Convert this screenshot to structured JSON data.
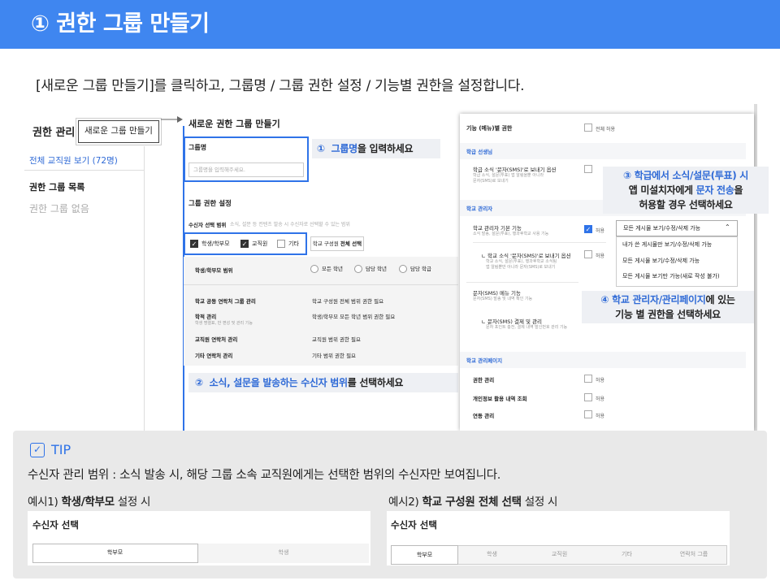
{
  "banner": {
    "title": "① 권한 그룹 만들기",
    "color": "#3f86f0"
  },
  "instruction": "[새로운 그룹 만들기]를 클릭하고, 그룹명 / 그룹 권한 설정 / 기능별 권한을 설정합니다.",
  "left": {
    "title": "권한 관리",
    "new_group_button": "새로운 그룹 만들기",
    "view_all": "전체 교직원 보기 (72명)",
    "group_list_title": "권한 그룹 목록",
    "no_group": "권한 그룹 없음"
  },
  "middle": {
    "title": "새로운 권한 그룹 만들기",
    "group_name_label": "그룹명",
    "group_name_placeholder": "그룹명을 입력해주세요.",
    "callout1": {
      "num": "①",
      "highlight": "그룹명",
      "rest": "을 입력하세요"
    },
    "perm_title": "그룹 권한 설정",
    "recipient_label": "수신자 선택 범위",
    "recipient_desc": "소식, 설문 등 컨텐츠 발송 시 수신자로 선택할 수 있는 범위",
    "checkboxes": [
      {
        "label": "학생/학부모",
        "checked": true
      },
      {
        "label": "교직원",
        "checked": true
      },
      {
        "label": "기타",
        "checked": false
      }
    ],
    "select_all_button": {
      "prefix": "학교 구성원 ",
      "bold": "전체 선택"
    },
    "scope_label": "학생/학부모 범위",
    "scope_radios": [
      "모든 학년",
      "담당 학년",
      "담당 학급"
    ],
    "scope_rows": [
      {
        "left": "학교 공동 연락처 그룹 관리",
        "sub": "",
        "right": "학교 구성원 전체 범위 권한 필요"
      },
      {
        "left": "학적 관리",
        "sub": "학생 명렬표, 반 편성 및 관리 기능",
        "right": "학생/학부모 모든 학년 범위 권한 필요"
      },
      {
        "left": "교직원 연락처 관리",
        "sub": "",
        "right": "교직원 범위 권한 필요"
      },
      {
        "left": "기타 연락처 관리",
        "sub": "",
        "right": "기타 범위 권한 필요"
      }
    ],
    "callout2": {
      "num": "②",
      "highlight": "소식, 설문을 발송하는 수신자 범위",
      "rest": "를 선택하세요"
    }
  },
  "right": {
    "header": "기능 (메뉴)별 권한",
    "all_allow": "전체 허용",
    "allow": "허용",
    "section_teacher": "학급 선생님",
    "teacher_item": {
      "title": "학급 소식 '문자(SMS)'로 보내기 옵션",
      "sub1": "학급 소식, 설문(투표) 앱 알림을뿐 아니라",
      "sub2": "문자(SMS)로 보내기"
    },
    "section_admin": "학교 관리자",
    "admin_item": {
      "title": "학교 관리자 기본 기능",
      "sub": "소식 발송, 설문(투표), 행과후학교 사용 기능"
    },
    "admin_sms_item": {
      "title": "ㄴ 학교 소식 '문자(SMS)'로 보내기 옵션",
      "sub1": "학교 소식, 설문(투표), 행과후학교 소식팀 ",
      "sub2": "앱 알림뿐만 아니라 문자(SMS)로 보내기"
    },
    "sms_menu": {
      "title": "문자(SMS) 메뉴 기능",
      "sub": "문자(SMS) 발송 및 내역 확인 기능"
    },
    "sms_pay": {
      "title": "ㄴ 문자(SMS) 결제 및 관리",
      "sub": "문자 포인트 충전, 결제 내역 발신번호 관리 기능"
    },
    "section_admin_page": "학교 관리페이지",
    "admin_page_items": [
      "권한 관리",
      "개인정보 활용 내역 조회",
      "연동 관리"
    ],
    "dropdown": {
      "value": "모든 게시물 보기/수정/삭제 가능",
      "caret": "⌃"
    },
    "dropdown_options": [
      "내가 쓴 게시물만 보기/수정/삭제 가능",
      "모든 게시물 보기/수정/삭제 가능",
      "모든 게시물 보기만 가능(새로 작성 불가)"
    ],
    "callout3": {
      "line1_num": "③",
      "line1_a": "학급에서 소식/설문(투표) 시",
      "line2_a": "앱 미설치자에게 ",
      "line2_b": "문자 전송",
      "line2_c": "을",
      "line3": "허용할 경우 선택하세요"
    },
    "callout4": {
      "num": "④",
      "highlight": "학교 관리자/관리페이지",
      "rest": "에 있는",
      "line2": "기능 별 권한을 선택하세요"
    }
  },
  "tip": {
    "label": "TIP",
    "icon": "check-square-icon",
    "text": "수신자 관리 범위 : 소식 발송 시, 해당 그룹 소속 교직원에게는  선택한 범위의 수신자만 보여집니다.",
    "ex1": {
      "prefix": "예시1)  ",
      "bold": "학생/학부모",
      "suffix": " 설정 시",
      "card_title": "수신자 선택",
      "tabs": [
        "학부모",
        "학생"
      ]
    },
    "ex2": {
      "prefix": "예시2)  ",
      "bold": "학교 구성원 전체 선택",
      "suffix": " 설정 시",
      "card_title": "수신자 선택",
      "tabs": [
        "학부모",
        "학생",
        "교직원",
        "기타",
        "연락처 그룹"
      ]
    }
  },
  "colors": {
    "accent": "#2f73e8",
    "link": "#2f6ad6",
    "callout_bg": "#eef0f4",
    "tip_bg": "#e9e9e9"
  }
}
